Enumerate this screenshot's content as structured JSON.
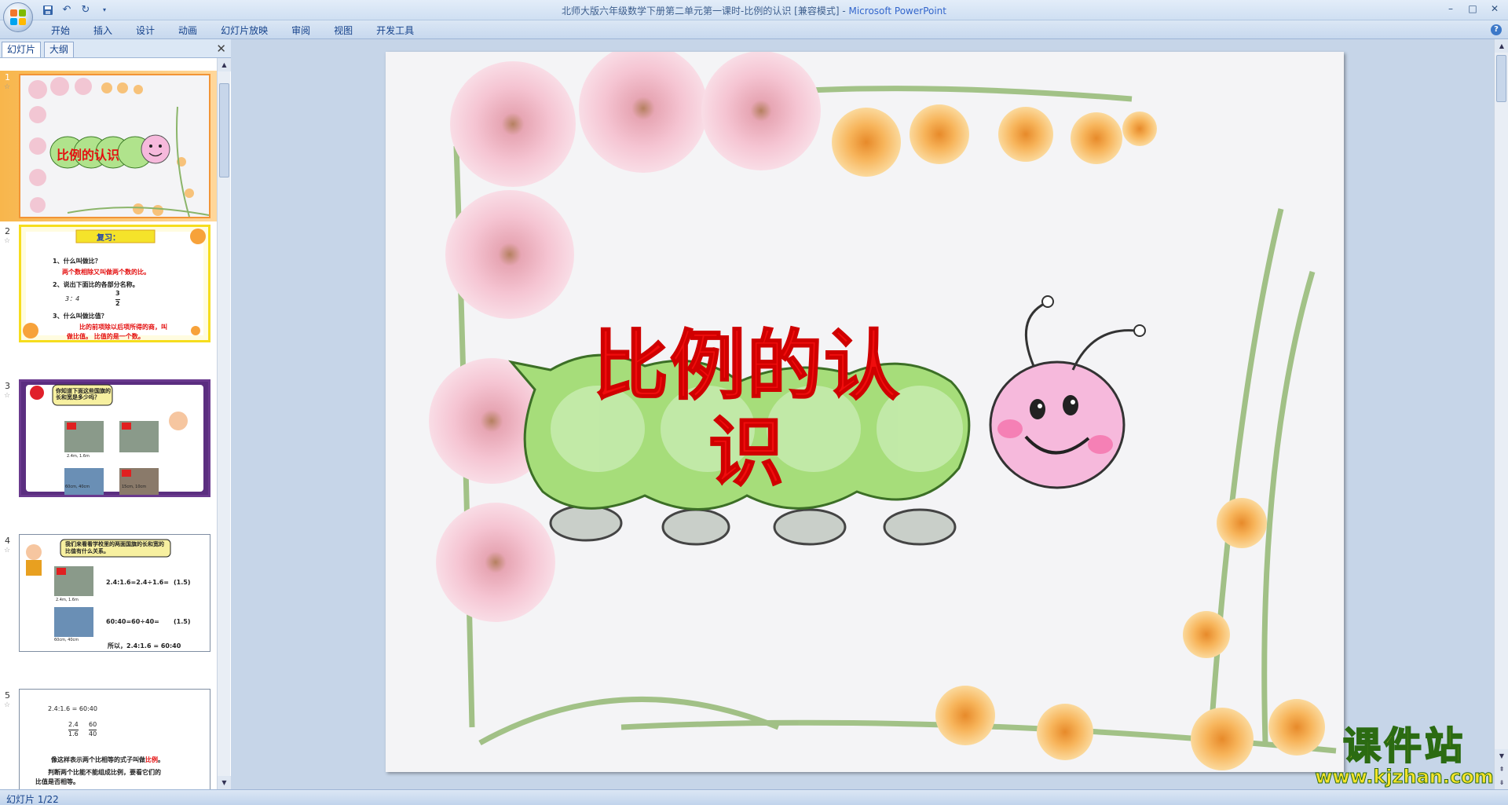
{
  "window": {
    "title": "北师大版六年级数学下册第二单元第一课时-比例的认识 [兼容模式]",
    "separator": " - ",
    "app_name": "Microsoft PowerPoint",
    "minimize": "–",
    "maximize": "□",
    "close": "✕"
  },
  "ribbon": {
    "tabs": [
      "开始",
      "插入",
      "设计",
      "动画",
      "幻灯片放映",
      "审阅",
      "视图",
      "开发工具"
    ],
    "help": "?"
  },
  "panel": {
    "tab_slides": "幻灯片",
    "tab_outline": "大纲",
    "close": "✕"
  },
  "slides": [
    {
      "number": "1",
      "title": "比例的认识"
    },
    {
      "number": "2",
      "heading": "复习：",
      "lines": [
        "1、什么叫做比？",
        "两个数相除又叫做两个数的比。",
        "2、说出下面比的各部分名称。",
        "3：4",
        "3",
        "2",
        "3、什么叫做比值？",
        "比的前项除以后项所得的商，叫",
        "做比值。 比值的是一个数。"
      ]
    },
    {
      "number": "3",
      "bubble": "你知道下面这些国旗的长和宽是多少吗？",
      "captions": [
        "2.4m, 1.6m",
        "60cm, 40cm",
        "15cm, 10cm"
      ]
    },
    {
      "number": "4",
      "bubble": "我们来看看学校里的两面国旗的长和宽的比值有什么关系。",
      "lines": [
        "2.4:1.6=2.4÷1.6=",
        "(1.5)",
        "60:40=60÷40=",
        "(1.5)",
        "所以，2.4:1.6 = 60:40",
        "也可以写成",
        "2.4",
        "1.6",
        "60",
        "40"
      ],
      "captions": [
        "2.4m, 1.6m",
        "60cm, 40cm"
      ]
    },
    {
      "number": "5",
      "lines": [
        "2.4:1.6 = 60:40",
        "2.4",
        "1.6",
        "60",
        "40",
        "像这样表示两个比相等的式子叫做",
        "比例",
        "。",
        "判断两个比能不能组成比例，要看它们的",
        "比值是否相等。"
      ]
    }
  ],
  "main_slide": {
    "title": "比例的认识"
  },
  "status": {
    "text": "幻灯片 1/22"
  },
  "watermark": {
    "title": "课件站",
    "url": "www.kjzhan.com"
  },
  "colors": {
    "accent_orange": "#f29436",
    "title_red": "#f00d0d",
    "caterpillar_green": "#a6dd7a",
    "caterpillar_pink": "#f6b9dc"
  }
}
